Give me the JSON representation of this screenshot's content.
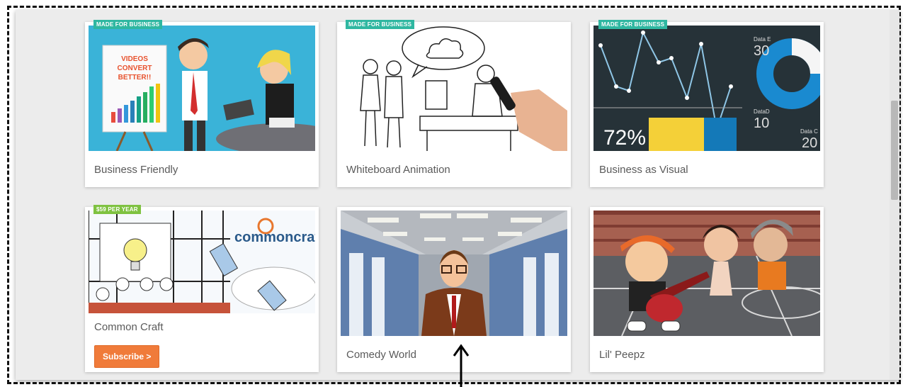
{
  "cards": [
    {
      "title": "Business Friendly",
      "badge": "MADE FOR BUSINESS",
      "thumb_text": [
        "VIDEOS",
        "CONVERT",
        "BETTER!!"
      ]
    },
    {
      "title": "Whiteboard Animation",
      "badge": "MADE FOR BUSINESS"
    },
    {
      "title": "Business as Visual",
      "badge": "MADE FOR BUSINESS",
      "stats": {
        "percent": "72%",
        "e_label": "Data E",
        "e_value": "30",
        "d_label": "DataD",
        "d_value": "10",
        "c_label": "Data C",
        "c_value": "20"
      }
    },
    {
      "title": "Common Craft",
      "badge": "$59 PER YEAR",
      "logo_text": "commoncraft",
      "button_label": "Subscribe >"
    },
    {
      "title": "Comedy World"
    },
    {
      "title": "Lil' Peepz"
    }
  ],
  "colors": {
    "badge_business": "#2fb7a1",
    "badge_price": "#7fc241",
    "subscribe_button": "#f07b3a"
  }
}
